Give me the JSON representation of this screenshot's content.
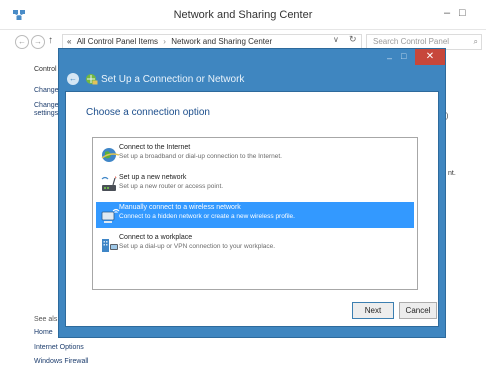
{
  "window": {
    "title": "Network and Sharing Center",
    "minimize": "–",
    "maximize": "□"
  },
  "address_bar": {
    "back": "←",
    "forward": "→",
    "up": "↑",
    "overflow": "«",
    "crumbs": [
      "All Control Panel Items",
      "Network and Sharing Center"
    ],
    "crumb_sep": "›",
    "dropdown": "∨",
    "refresh": "↻",
    "search_placeholder": "Search Control Panel",
    "search_icon": "⌕"
  },
  "sidebar": {
    "control_fragment": "Control",
    "change_1": "Change",
    "change_2": "Change",
    "settings_fragment": "settings",
    "see_also_fragment": "See als",
    "homegroup_fragment": "Home",
    "link_internet_options": "Internet Options",
    "link_windows_firewall": "Windows Firewall"
  },
  "right_fragments": {
    "paren": ")",
    "nt": "nt."
  },
  "dialog": {
    "title": "Set Up a Connection or Network",
    "back_glyph": "←",
    "minimize": "–",
    "maximize": "□",
    "close": "✕",
    "instruction": "Choose a connection option",
    "options": [
      {
        "title": "Connect to the Internet",
        "description": "Set up a broadband or dial-up connection to the Internet.",
        "icon": "globe-icon",
        "selected": false
      },
      {
        "title": "Set up a new network",
        "description": "Set up a new router or access point.",
        "icon": "router-icon",
        "selected": false
      },
      {
        "title": "Manually connect to a wireless network",
        "description": "Connect to a hidden network or create a new wireless profile.",
        "icon": "wireless-network-icon",
        "selected": true
      },
      {
        "title": "Connect to a workplace",
        "description": "Set up a dial-up or VPN connection to your workplace.",
        "icon": "workplace-icon",
        "selected": false
      }
    ],
    "next_label": "Next",
    "cancel_label": "Cancel"
  },
  "colors": {
    "dialog_frame": "#3f86c0",
    "selection": "#3399ff",
    "close_button": "#c7473b",
    "instruction_text": "#1c4e8c"
  }
}
